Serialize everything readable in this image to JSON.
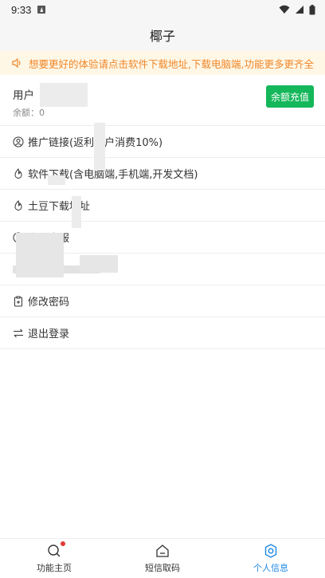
{
  "status_bar": {
    "time": "9:33"
  },
  "header": {
    "title": "椰子"
  },
  "notice": {
    "text": "想要更好的体验请点击软件下载地址,下载电脑端,功能更多更齐全",
    "color": "#f0872a"
  },
  "user": {
    "name_label": "用户",
    "balance_label": "余额",
    "balance_value": "0",
    "recharge_label": "余额充值",
    "recharge_color": "#14b75a"
  },
  "menu": {
    "items": [
      {
        "label": "推广链接(返利用户消费10%)",
        "icon": "user-circle-icon"
      },
      {
        "label": "软件下载(含电脑端,手机端,开发文档)",
        "icon": "flame-icon"
      },
      {
        "label": "土豆下载地址",
        "icon": "flame-icon"
      },
      {
        "label": "土豆客服",
        "icon": "smile-icon"
      },
      {
        "label": "",
        "icon": "redacted"
      },
      {
        "label": "修改密码",
        "icon": "clipboard-icon"
      },
      {
        "label": "退出登录",
        "icon": "swap-arrows-icon"
      }
    ]
  },
  "bottom_nav": {
    "tabs": [
      {
        "label": "功能主页",
        "icon": "search-icon",
        "active": false
      },
      {
        "label": "短信取码",
        "icon": "home-icon",
        "active": false
      },
      {
        "label": "个人信息",
        "icon": "gear-icon",
        "active": true
      }
    ],
    "active_color": "#1e88e5"
  }
}
